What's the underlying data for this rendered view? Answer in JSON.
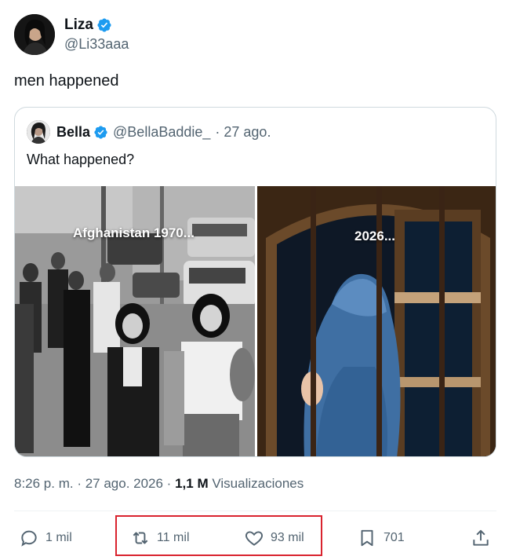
{
  "author": {
    "display_name": "Liza",
    "handle": "@Li33aaa"
  },
  "tweet": {
    "text": "men happened"
  },
  "quoted": {
    "display_name": "Bella",
    "handle": "@BellaBaddie_",
    "date": "· 27 ago.",
    "text": "What happened?",
    "images": [
      {
        "overlay_text": "Afghanistan 1970..."
      },
      {
        "overlay_text": "2026..."
      }
    ]
  },
  "meta": {
    "time_date": "8:26 p. m. · 27 ago. 2026 ·",
    "views_count": "1,1 M",
    "views_label": "Visualizaciones"
  },
  "actions": {
    "replies": "1 mil",
    "retweets": "11 mil",
    "likes": "93 mil",
    "bookmarks": "701"
  },
  "colors": {
    "verified": "#1d9bf0",
    "highlight": "#d9232e",
    "secondary_text": "#536471"
  }
}
